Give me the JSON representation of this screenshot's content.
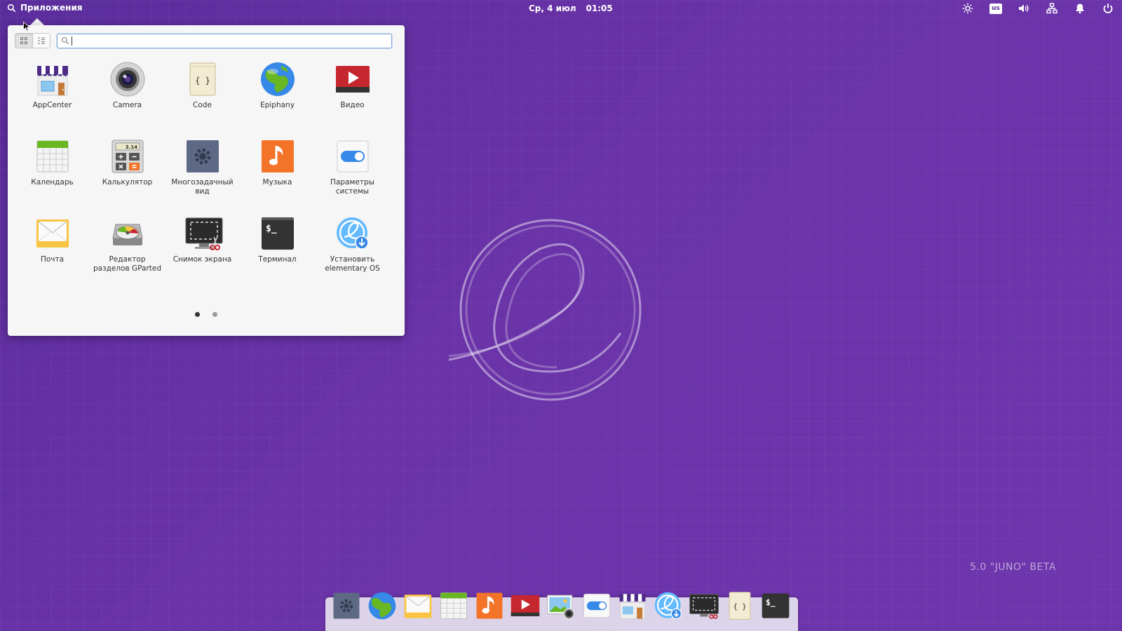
{
  "panel": {
    "apps_label": "Приложения",
    "date": "Ср, 4 июл",
    "time": "01:05",
    "keyboard_layout": "us"
  },
  "launcher": {
    "search": {
      "value": "",
      "placeholder": ""
    },
    "apps": [
      {
        "name": "AppCenter",
        "icon": "appcenter-icon"
      },
      {
        "name": "Camera",
        "icon": "camera-icon"
      },
      {
        "name": "Code",
        "icon": "code-icon"
      },
      {
        "name": "Epiphany",
        "icon": "epiphany-icon"
      },
      {
        "name": "Видео",
        "icon": "video-icon"
      },
      {
        "name": "Календарь",
        "icon": "calendar-icon"
      },
      {
        "name": "Калькулятор",
        "icon": "calculator-icon"
      },
      {
        "name": "Многозадачный вид",
        "icon": "multitasking-icon"
      },
      {
        "name": "Музыка",
        "icon": "music-icon"
      },
      {
        "name": "Параметры системы",
        "icon": "system-settings-icon"
      },
      {
        "name": "Почта",
        "icon": "mail-icon"
      },
      {
        "name": "Редактор разделов GParted",
        "icon": "gparted-icon"
      },
      {
        "name": "Снимок экрана",
        "icon": "screenshot-icon"
      },
      {
        "name": "Терминал",
        "icon": "terminal-icon"
      },
      {
        "name": "Установить elementary OS",
        "icon": "installer-icon"
      }
    ],
    "pages": {
      "current": 1,
      "total": 2
    },
    "calculator_display": "3.14",
    "code_glyph": "{ }",
    "terminal_glyph": "$_"
  },
  "watermark": {
    "version": "5.0 \"JUNO\" BETA"
  },
  "dock": {
    "items": [
      "multitasking-icon",
      "epiphany-icon",
      "mail-icon",
      "calendar-icon",
      "music-icon",
      "video-icon",
      "photos-icon",
      "system-settings-icon",
      "appcenter-icon",
      "installer-icon",
      "screenshot-icon",
      "code-icon",
      "terminal-icon"
    ]
  },
  "colors": {
    "wallpaper": "#5b2d9c",
    "accent_blue": "#3689e6",
    "red": "#d43c3c",
    "orange": "#f37329",
    "green": "#68b723"
  }
}
